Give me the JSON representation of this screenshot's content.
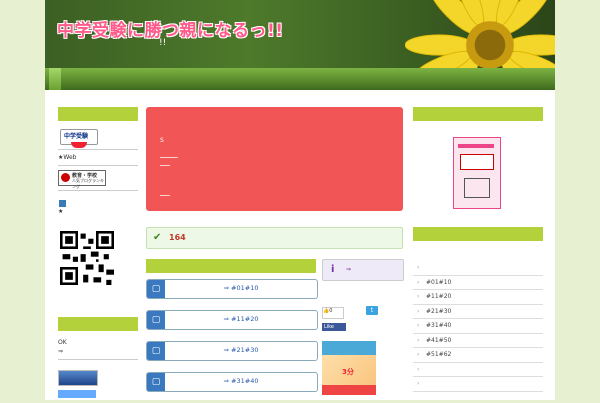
{
  "header": {
    "title": "中学受験に勝つ親になるっ!!",
    "subtitle": "!!"
  },
  "left": {
    "badge": "中学受験",
    "web_label": "★Web",
    "rank_title": "教育・学校",
    "rank_sub": "人気ブログランキング",
    "star": "★",
    "ok": "OK",
    "arrow": "⇒"
  },
  "center": {
    "red_box_text": "S",
    "counter": "164",
    "list": [
      {
        "label": "⇒ #01#10",
        "icon": "book-icon"
      },
      {
        "label": "⇒ #11#20",
        "icon": "book-icon"
      },
      {
        "label": "⇒ #21#30",
        "icon": "book-icon"
      },
      {
        "label": "⇒ #31#40",
        "icon": "book-icon"
      }
    ]
  },
  "social": {
    "info_icon": "i",
    "info_arrow": "⇒",
    "like_count": "0",
    "fb_like": "Like",
    "twitter": "t",
    "ad_text": "3分"
  },
  "right": {
    "links": [
      "",
      "#01#10",
      "#11#20",
      "#21#30",
      "#31#40",
      "#41#50",
      "#51#62",
      "",
      ""
    ]
  },
  "colors": {
    "accent_green": "#b3d13a",
    "red_box": "#f25555",
    "list_blue": "#3a78c0"
  }
}
